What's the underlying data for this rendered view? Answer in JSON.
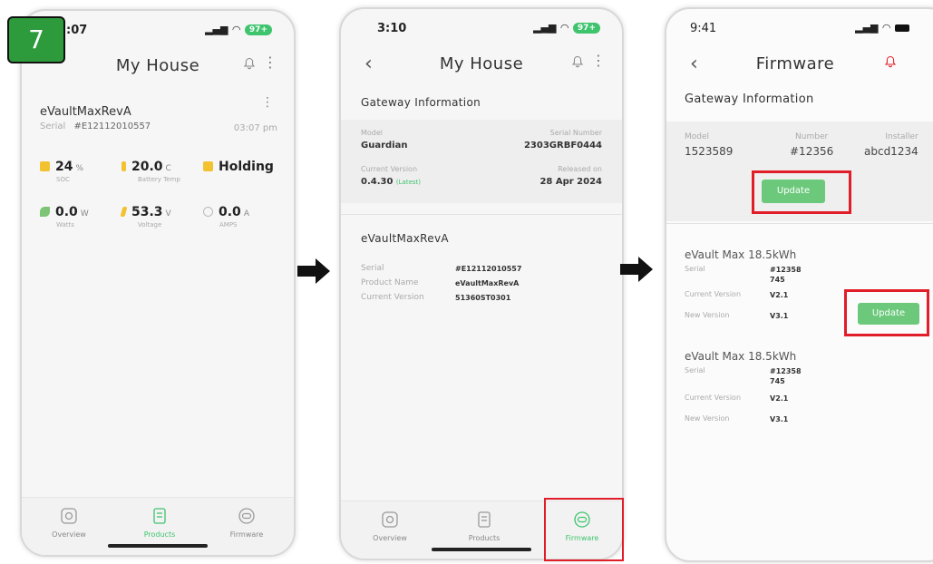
{
  "step_badge": "7",
  "phone1": {
    "status_time": "3:07",
    "battery": "97+",
    "title": "My House",
    "product": {
      "name": "eVaultMaxRevA",
      "serial_label": "Serial",
      "serial_value": "#E12112010557",
      "time": "03:07 pm"
    },
    "metrics": [
      {
        "value": "24",
        "unit": "%",
        "label": "SOC",
        "icon_color": "#f2c230"
      },
      {
        "value": "20.0",
        "unit": "C",
        "label": "Battery Temp",
        "icon_color": "#f2c230"
      },
      {
        "value": "Holding",
        "unit": "",
        "label": "",
        "icon_color": "#f2c230"
      },
      {
        "value": "0.0",
        "unit": "W",
        "label": "Watts",
        "icon_color": "#7cc576"
      },
      {
        "value": "53.3",
        "unit": "V",
        "label": "Voltage",
        "icon_color": "#f2c230"
      },
      {
        "value": "0.0",
        "unit": "A",
        "label": "AMPS",
        "icon_color": "#bbbbbb"
      }
    ],
    "tabs": {
      "overview": "Overview",
      "products": "Products",
      "firmware": "Firmware"
    }
  },
  "phone2": {
    "status_time": "3:10",
    "battery": "97+",
    "title": "My House",
    "gateway_heading": "Gateway Information",
    "model_label": "Model",
    "model_value": "Guardian",
    "serial_label": "Serial Number",
    "serial_value": "2303GRBF0444",
    "current_label": "Current Version",
    "current_value": "0.4.30",
    "latest_tag": "(Latest)",
    "released_label": "Released on",
    "released_value": "28 Apr 2024",
    "product_heading": "eVaultMaxRevA",
    "rows": [
      {
        "k": "Serial",
        "v": "#E12112010557"
      },
      {
        "k": "Product Name",
        "v": "eVaultMaxRevA"
      },
      {
        "k": "Current Version",
        "v": "51360ST0301"
      }
    ],
    "tabs": {
      "overview": "Overview",
      "products": "Products",
      "firmware": "Firmware"
    }
  },
  "phone3": {
    "status_time": "9:41",
    "title": "Firmware",
    "gateway_heading": "Gateway Information",
    "model_label": "Model",
    "model_value": "1523589",
    "number_label": "Number",
    "number_value": "#12356",
    "installer_label": "Installer",
    "installer_value": "abcd1234",
    "update_label": "Update",
    "items": [
      {
        "name": "eVault Max 18.5kWh",
        "serial_label": "Serial",
        "serial_line1": "#12358",
        "serial_line2": "745",
        "current_label": "Current Version",
        "current_value": "V2.1",
        "new_label": "New Version",
        "new_value": "V3.1"
      },
      {
        "name": "eVault Max 18.5kWh",
        "serial_label": "Serial",
        "serial_line1": "#12358",
        "serial_line2": "745",
        "current_label": "Current Version",
        "current_value": "V2.1",
        "new_label": "New Version",
        "new_value": "V3.1"
      }
    ]
  },
  "colors": {
    "accent_green": "#3ec46d",
    "button_green": "#6cc97c",
    "highlight_red": "#e21d2a"
  }
}
